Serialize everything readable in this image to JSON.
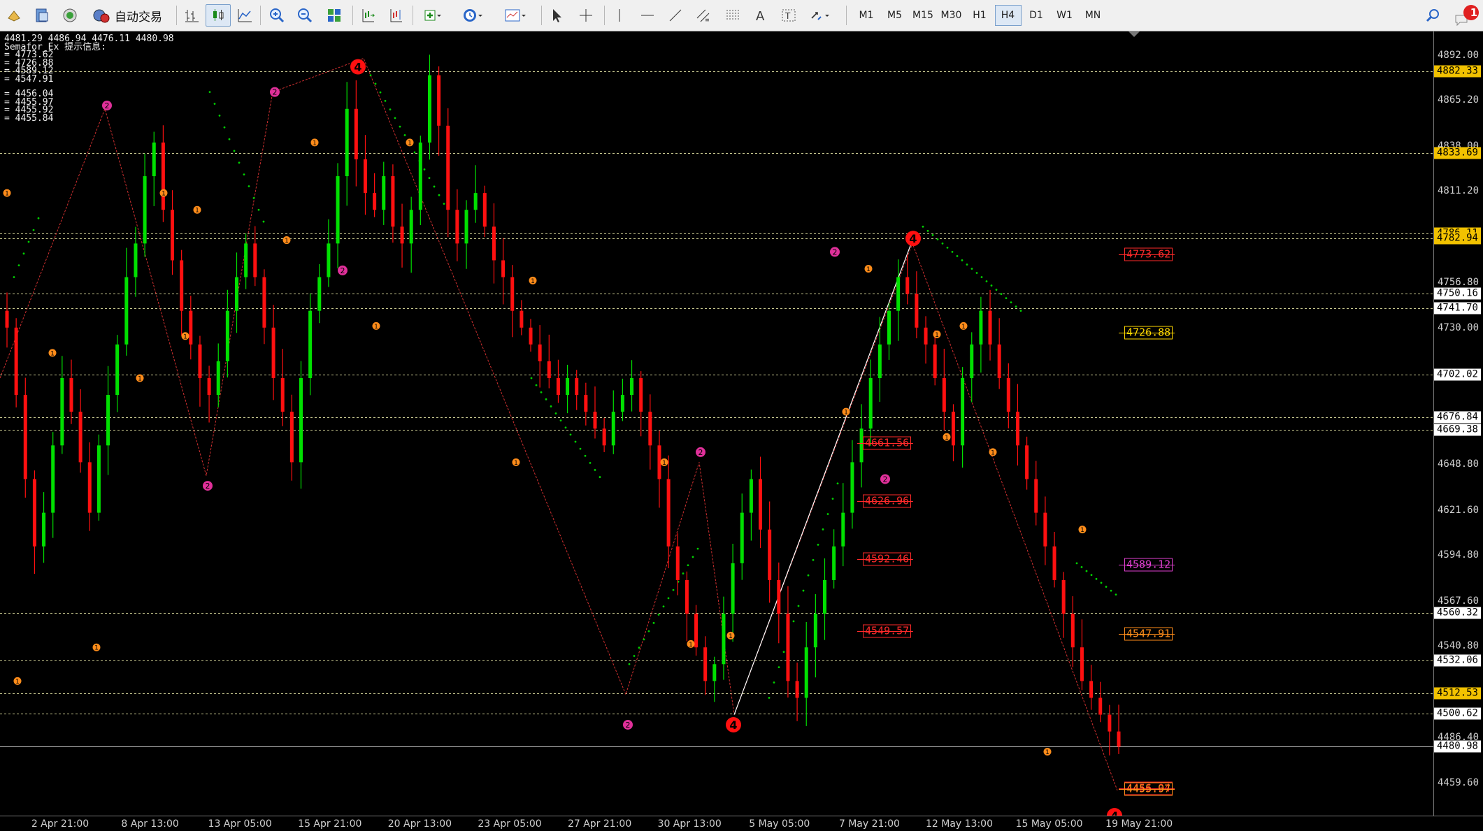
{
  "toolbar": {
    "autotrade_label": "自动交易",
    "timeframes": [
      "M1",
      "M5",
      "M15",
      "M30",
      "H1",
      "H4",
      "D1",
      "W1",
      "MN"
    ],
    "active_timeframe": "H4",
    "notification_count": "1"
  },
  "info": {
    "ohlc": "4481.29 4486.94 4476.11 4480.98",
    "indicator_title": "Semafor_Ex 提示信息:",
    "upper_levels": [
      "= 4773.62",
      "= 4726.88",
      "= 4589.12",
      "= 4547.91"
    ],
    "lower_levels": [
      "= 4456.04",
      "= 4455.97",
      "= 4455.92",
      "= 4455.84"
    ]
  },
  "price_axis": {
    "min": 4440,
    "max": 4906,
    "ticks": [
      "4892.00",
      "4865.20",
      "4838.00",
      "4811.20",
      "4756.80",
      "4730.00",
      "4648.80",
      "4621.60",
      "4594.80",
      "4567.60",
      "4540.80",
      "4486.40",
      "4459.60"
    ],
    "tags": [
      {
        "price": 4882.33,
        "label": "4882.33",
        "color": "#f2c200"
      },
      {
        "price": 4833.69,
        "label": "4833.69",
        "color": "#f2c200"
      },
      {
        "price": 4786.11,
        "label": "4786.11",
        "color": "#f2c200"
      },
      {
        "price": 4782.94,
        "label": "4782.94",
        "color": "#f2c200"
      },
      {
        "price": 4750.16,
        "label": "4750.16",
        "color": "#ffffff"
      },
      {
        "price": 4741.7,
        "label": "4741.70",
        "color": "#ffffff"
      },
      {
        "price": 4702.02,
        "label": "4702.02",
        "color": "#ffffff"
      },
      {
        "price": 4676.84,
        "label": "4676.84",
        "color": "#ffffff"
      },
      {
        "price": 4669.38,
        "label": "4669.38",
        "color": "#ffffff"
      },
      {
        "price": 4560.32,
        "label": "4560.32",
        "color": "#ffffff"
      },
      {
        "price": 4532.06,
        "label": "4532.06",
        "color": "#ffffff"
      },
      {
        "price": 4512.53,
        "label": "4512.53",
        "color": "#f2c200"
      },
      {
        "price": 4500.62,
        "label": "4500.62",
        "color": "#ffffff"
      },
      {
        "price": 4480.98,
        "label": "4480.98",
        "color": "#ffffff"
      }
    ]
  },
  "date_axis": [
    "2 Apr 21:00",
    "8 Apr 13:00",
    "13 Apr 05:00",
    "15 Apr 21:00",
    "20 Apr 13:00",
    "23 Apr 05:00",
    "27 Apr 21:00",
    "30 Apr 13:00",
    "5 May 05:00",
    "7 May 21:00",
    "12 May 13:00",
    "15 May 05:00",
    "19 May 21:00"
  ],
  "levels_right": [
    {
      "price": 4773.62,
      "label": "4773.62",
      "color": "#ff2a2a"
    },
    {
      "price": 4726.88,
      "label": "4726.88",
      "color": "#ffd800"
    },
    {
      "price": 4589.12,
      "label": "4589.12",
      "color": "#e040d0"
    },
    {
      "price": 4547.91,
      "label": "4547.91",
      "color": "#ff8c1a"
    },
    {
      "price": 4456.04,
      "label": "4456.04",
      "color": "#ff2a2a"
    },
    {
      "price": 4455.97,
      "label": "4455.97",
      "color": "#ff8c1a"
    }
  ],
  "levels_mid": [
    {
      "price": 4661.56,
      "label": "4661.56",
      "color": "#ff2a2a"
    },
    {
      "price": 4626.96,
      "label": "4626.96",
      "color": "#ff2a2a"
    },
    {
      "price": 4592.46,
      "label": "4592.46",
      "color": "#ff2a2a"
    },
    {
      "price": 4549.57,
      "label": "4549.57",
      "color": "#ff2a2a"
    }
  ],
  "colors": {
    "bull": "#00e000",
    "bear": "#ff1010",
    "grid": "#c8c890"
  },
  "chart_data": {
    "type": "candlestick",
    "instrument_timeframe": "H4",
    "closes": [
      4730,
      4690,
      4640,
      4600,
      4620,
      4660,
      4700,
      4680,
      4650,
      4620,
      4660,
      4690,
      4720,
      4760,
      4780,
      4820,
      4840,
      4800,
      4770,
      4740,
      4720,
      4700,
      4690,
      4710,
      4740,
      4760,
      4780,
      4760,
      4730,
      4700,
      4680,
      4650,
      4700,
      4740,
      4760,
      4780,
      4820,
      4860,
      4830,
      4810,
      4800,
      4820,
      4790,
      4780,
      4800,
      4840,
      4880,
      4850,
      4800,
      4780,
      4800,
      4810,
      4790,
      4770,
      4760,
      4740,
      4730,
      4720,
      4710,
      4700,
      4690,
      4700,
      4690,
      4680,
      4670,
      4660,
      4680,
      4690,
      4700,
      4680,
      4660,
      4640,
      4600,
      4580,
      4560,
      4540,
      4520,
      4530,
      4560,
      4590,
      4620,
      4640,
      4610,
      4580,
      4560,
      4520,
      4510,
      4540,
      4560,
      4580,
      4600,
      4620,
      4650,
      4670,
      4700,
      4720,
      4740,
      4760,
      4750,
      4730,
      4720,
      4700,
      4680,
      4660,
      4700,
      4720,
      4740,
      4720,
      4700,
      4680,
      4660,
      4640,
      4620,
      4600,
      4580,
      4560,
      4540,
      4520,
      4510,
      4500,
      4490,
      4481
    ],
    "semafor_markers": [
      {
        "label": "4",
        "price": 4885,
        "kind": "high"
      },
      {
        "label": "4",
        "price": 4500,
        "kind": "low"
      },
      {
        "label": "4",
        "price": 4777,
        "kind": "high"
      },
      {
        "label": "2",
        "price": 4860,
        "kind": "high"
      },
      {
        "label": "2",
        "price": 4642,
        "kind": "low"
      },
      {
        "label": "2",
        "price": 4870,
        "kind": "high"
      },
      {
        "label": "2",
        "price": 4755,
        "kind": "low"
      },
      {
        "label": "2",
        "price": 4650,
        "kind": "high"
      },
      {
        "label": "2",
        "price": 4510,
        "kind": "low"
      },
      {
        "label": "2",
        "price": 4765,
        "kind": "high"
      },
      {
        "label": "2",
        "price": 4640,
        "kind": "low"
      }
    ]
  }
}
